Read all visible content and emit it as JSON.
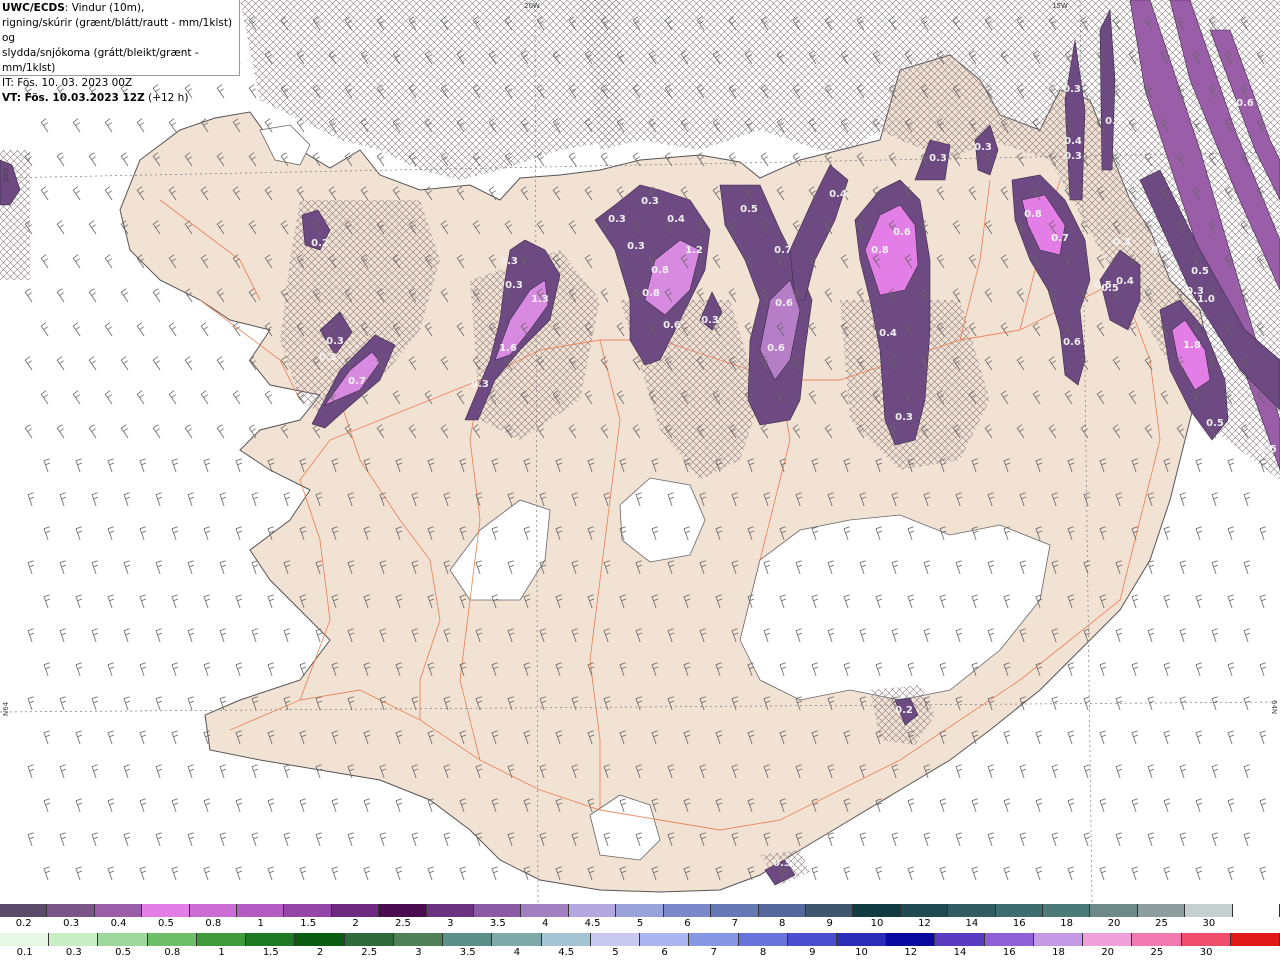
{
  "info": {
    "model_name": "UWC/ECDS",
    "line1_rest": ": Vindur (10m),",
    "line2": "rigning/skúrir (grænt/blátt/rautt - mm/1klst) og",
    "line3": "slydda/snjókoma (grátt/bleikt/grænt - mm/1klst)",
    "issue_time": "IT: Fös. 10. 03. 2023 00Z",
    "valid_prefix": "VT: Fös. 10.03.2023 12Z",
    "valid_suffix": " (+12 h)"
  },
  "grid_labels": {
    "lon_20w": "20W",
    "lon_15w": "15W",
    "lat_left_top": "N65",
    "lat_left_bottom": "N64",
    "lat_right_bottom": "64N"
  },
  "precip_labels": [
    "0.2",
    "0.3",
    "0.3",
    "0.7",
    "0.3",
    "0.3",
    "1.3",
    "1.6",
    "0.3",
    "0.3",
    "0.3",
    "0.3",
    "0.4",
    "1.2",
    "0.8",
    "0.8",
    "0.6",
    "0.3",
    "0.5",
    "0.4",
    "0.7",
    "0.6",
    "0.6",
    "0.8",
    "0.6",
    "0.4",
    "0.3",
    "0.3",
    "0.3",
    "0.8",
    "0.7",
    "0.3",
    "0.5",
    "0.4",
    "0.6",
    "0.5",
    "0.4",
    "0.3",
    "0.3",
    "0.6",
    "0.5",
    "1.0",
    "0.3",
    "1.8",
    "0.5",
    "0.5",
    "0.6",
    "0.5",
    "0.2",
    "0.3"
  ],
  "snow_scale": {
    "labels": [
      "0.2",
      "0.3",
      "0.4",
      "0.5",
      "0.8",
      "1",
      "1.5",
      "2",
      "2.5",
      "3",
      "3.5",
      "4",
      "4.5",
      "5",
      "6",
      "7",
      "8",
      "9",
      "10",
      "12",
      "14",
      "16",
      "18",
      "20",
      "25",
      "30"
    ],
    "colors": [
      "#5c4a6a",
      "#7a5688",
      "#9a5ea8",
      "#e27ee6",
      "#cc6dd6",
      "#b25cc4",
      "#9446a8",
      "#6e2a7e",
      "#4a0c4e",
      "#6a3280",
      "#8a5aa4",
      "#a07ec0",
      "#b4a6de",
      "#9aa2dc",
      "#7c88cc",
      "#6678b4",
      "#54689c",
      "#3e566e",
      "#113c44",
      "#1f4a52",
      "#305c62",
      "#3f6c6e",
      "#4c7a78",
      "#6d8a88",
      "#8e9e9e",
      "#c4d0d0",
      "#ffffff"
    ]
  },
  "rain_scale": {
    "labels": [
      "0.1",
      "0.3",
      "0.5",
      "0.8",
      "1",
      "1.5",
      "2",
      "2.5",
      "3",
      "3.5",
      "4",
      "4.5",
      "5",
      "6",
      "7",
      "8",
      "9",
      "10",
      "12",
      "14",
      "16",
      "18",
      "20",
      "25",
      "30"
    ],
    "colors": [
      "#e6f7e6",
      "#c7eec5",
      "#9fd89c",
      "#6fbf6a",
      "#3f9a3c",
      "#1e7a22",
      "#0b5a12",
      "#2f6b3a",
      "#4f8058",
      "#5a8f88",
      "#7fa8a8",
      "#a4c4d4",
      "#c8c8f0",
      "#aab4f0",
      "#8896e6",
      "#6a72dc",
      "#4c4cd0",
      "#2c2cb8",
      "#0a0aa0",
      "#5a3ac0",
      "#9060d8",
      "#c49ae6",
      "#f0a0d8",
      "#f07ab0",
      "#f04c6c",
      "#e01818"
    ]
  }
}
